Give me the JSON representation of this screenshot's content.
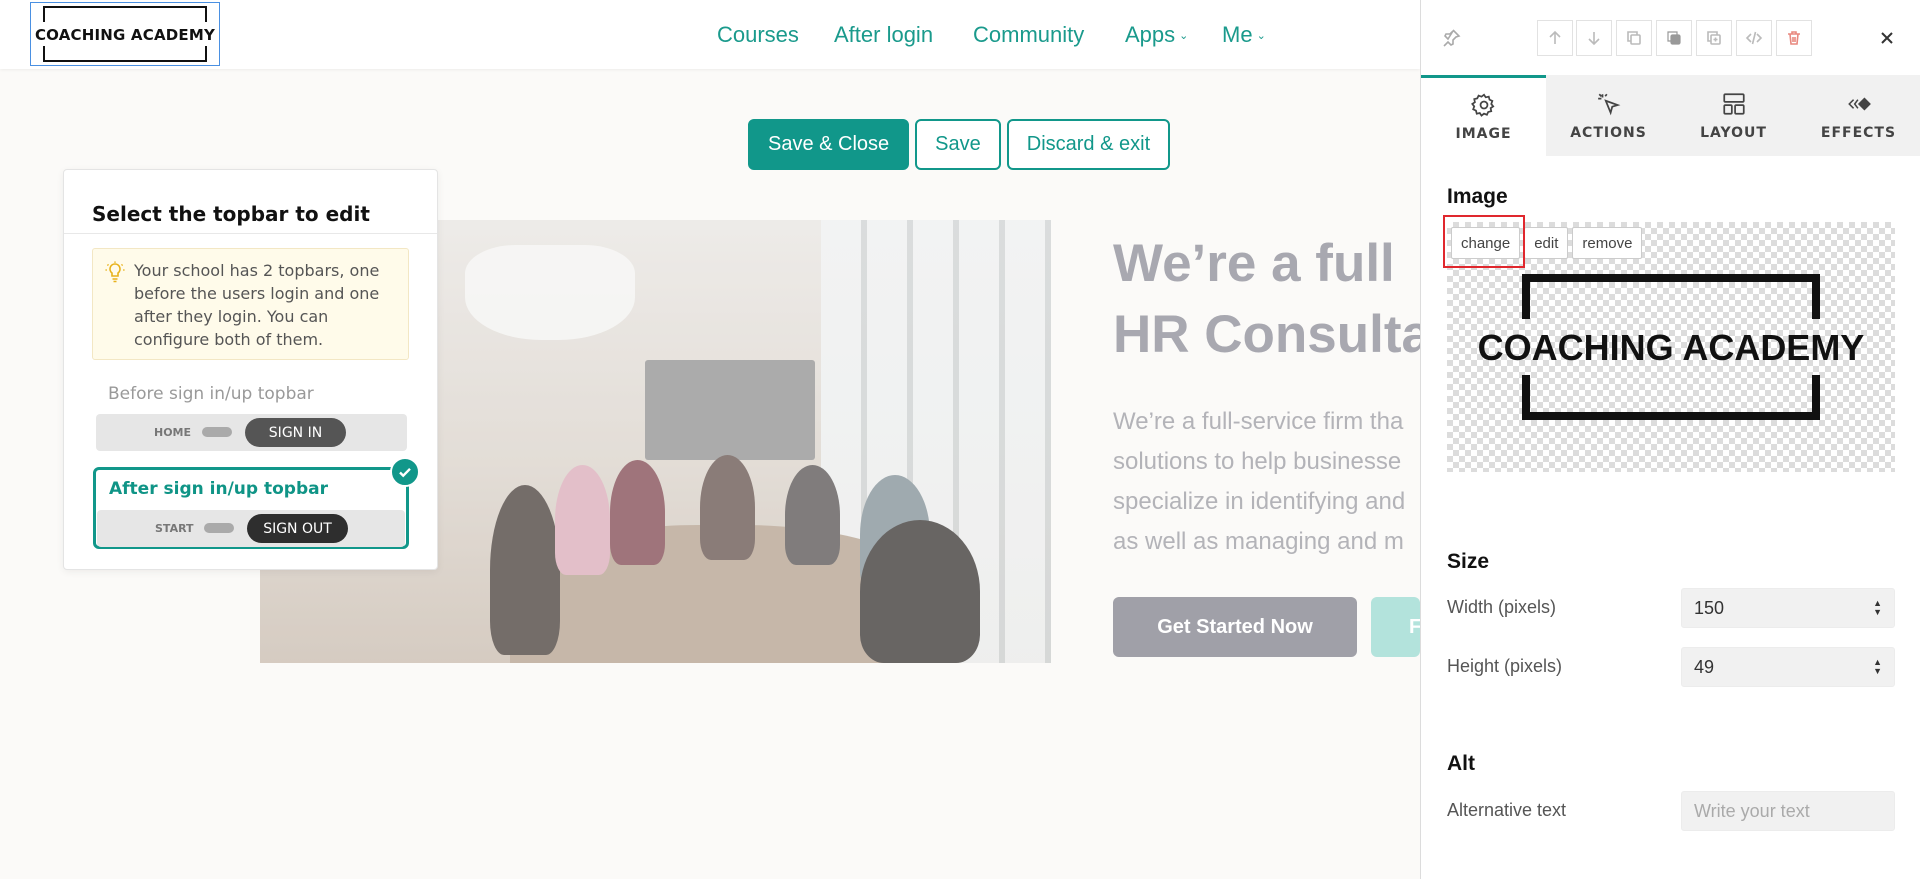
{
  "topbar": {
    "logo_text": "COACHING ACADEMY",
    "nav": [
      {
        "label": "Courses",
        "dropdown": false
      },
      {
        "label": "After login",
        "dropdown": false
      },
      {
        "label": "Community",
        "dropdown": false
      },
      {
        "label": "Apps",
        "dropdown": true
      },
      {
        "label": "Me",
        "dropdown": true
      }
    ]
  },
  "actions": {
    "save_close": "Save & Close",
    "save": "Save",
    "discard": "Discard & exit"
  },
  "hero": {
    "title_line1": "We’re a full",
    "title_line2": "HR Consulta",
    "text_lines": [
      "We’re a full-service firm tha",
      "solutions to help businesse",
      "specialize in identifying and",
      "as well as managing and m"
    ],
    "cta_primary": "Get Started Now",
    "cta_secondary": "F"
  },
  "select_panel": {
    "title": "Select the topbar to edit",
    "notice": "Your school has 2 topbars, one before the users login and one after they login. You can configure both of them.",
    "before_label": "Before sign in/up topbar",
    "before_link": "HOME",
    "before_button": "SIGN IN",
    "after_label": "After sign in/up topbar",
    "after_link": "START",
    "after_button": "SIGN OUT"
  },
  "sidepanel": {
    "tabs": [
      {
        "label": "IMAGE",
        "icon": "gear-icon",
        "active": true
      },
      {
        "label": "ACTIONS",
        "icon": "cursor-click-icon",
        "active": false
      },
      {
        "label": "LAYOUT",
        "icon": "layout-icon",
        "active": false
      },
      {
        "label": "EFFECTS",
        "icon": "effects-icon",
        "active": false
      }
    ],
    "image_section": "Image",
    "image_buttons": {
      "change": "change",
      "edit": "edit",
      "remove": "remove"
    },
    "preview_text": "COACHING ACADEMY",
    "size_section": "Size",
    "width_label": "Width (pixels)",
    "width_value": "150",
    "height_label": "Height (pixels)",
    "height_value": "49",
    "alt_section": "Alt",
    "alt_label": "Alternative text",
    "alt_placeholder": "Write your text"
  },
  "colors": {
    "accent": "#11978a",
    "nav_link": "#1a9a8c",
    "highlight": "#e0282e",
    "delete": "#e8887f"
  }
}
